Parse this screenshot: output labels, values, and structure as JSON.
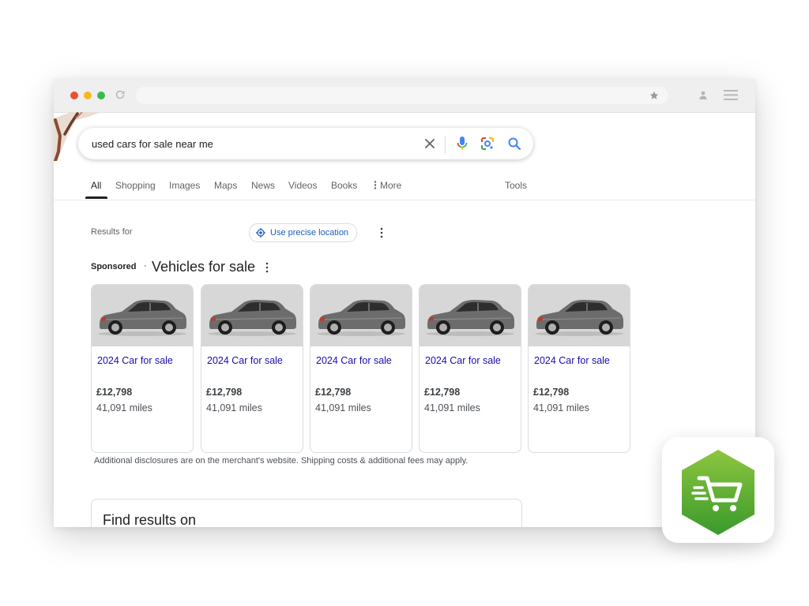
{
  "browser": {
    "traffic_lights": [
      "close",
      "minimize",
      "maximize"
    ],
    "icons": [
      "reload-icon",
      "bookmark-star-icon",
      "profile-icon",
      "menu-icon"
    ]
  },
  "search": {
    "query": "used cars for sale near me",
    "icons": [
      "clear-icon",
      "mic-icon",
      "lens-icon",
      "search-icon"
    ],
    "accent": "#4285f4"
  },
  "tabs": [
    {
      "label": "All",
      "active": true
    },
    {
      "label": "Shopping"
    },
    {
      "label": "Images"
    },
    {
      "label": "Maps"
    },
    {
      "label": "News"
    },
    {
      "label": "Videos"
    },
    {
      "label": "Books"
    },
    {
      "label": "More"
    }
  ],
  "tools_label": "Tools",
  "location": {
    "results_for": "Results for",
    "precise_button": "Use precise location"
  },
  "ads": {
    "sponsored_label": "Sponsored",
    "separator": "·",
    "title": "Vehicles for sale",
    "cards": [
      {
        "title": "2024 Car for sale",
        "price": "£12,798",
        "miles": "41,091 miles"
      },
      {
        "title": "2024 Car for sale",
        "price": "£12,798",
        "miles": "41,091 miles"
      },
      {
        "title": "2024 Car for sale",
        "price": "£12,798",
        "miles": "41,091 miles"
      },
      {
        "title": "2024 Car for sale",
        "price": "£12,798",
        "miles": "41,091 miles"
      },
      {
        "title": "2024 Car for sale",
        "price": "£12,798",
        "miles": "41,091 miles"
      }
    ],
    "disclosure": "Additional disclosures are on the merchant's website. Shipping costs & additional fees may apply."
  },
  "find_results": {
    "title": "Find results on"
  },
  "app_badge": {
    "icon": "shopping-cart-icon",
    "colors": {
      "gradient_top": "#8dc63f",
      "gradient_bottom": "#3a9a2c"
    }
  },
  "colors": {
    "link": "#1a0dab",
    "chrome_bar": "#efefef",
    "card_image_bg": "#d7d7d7"
  }
}
